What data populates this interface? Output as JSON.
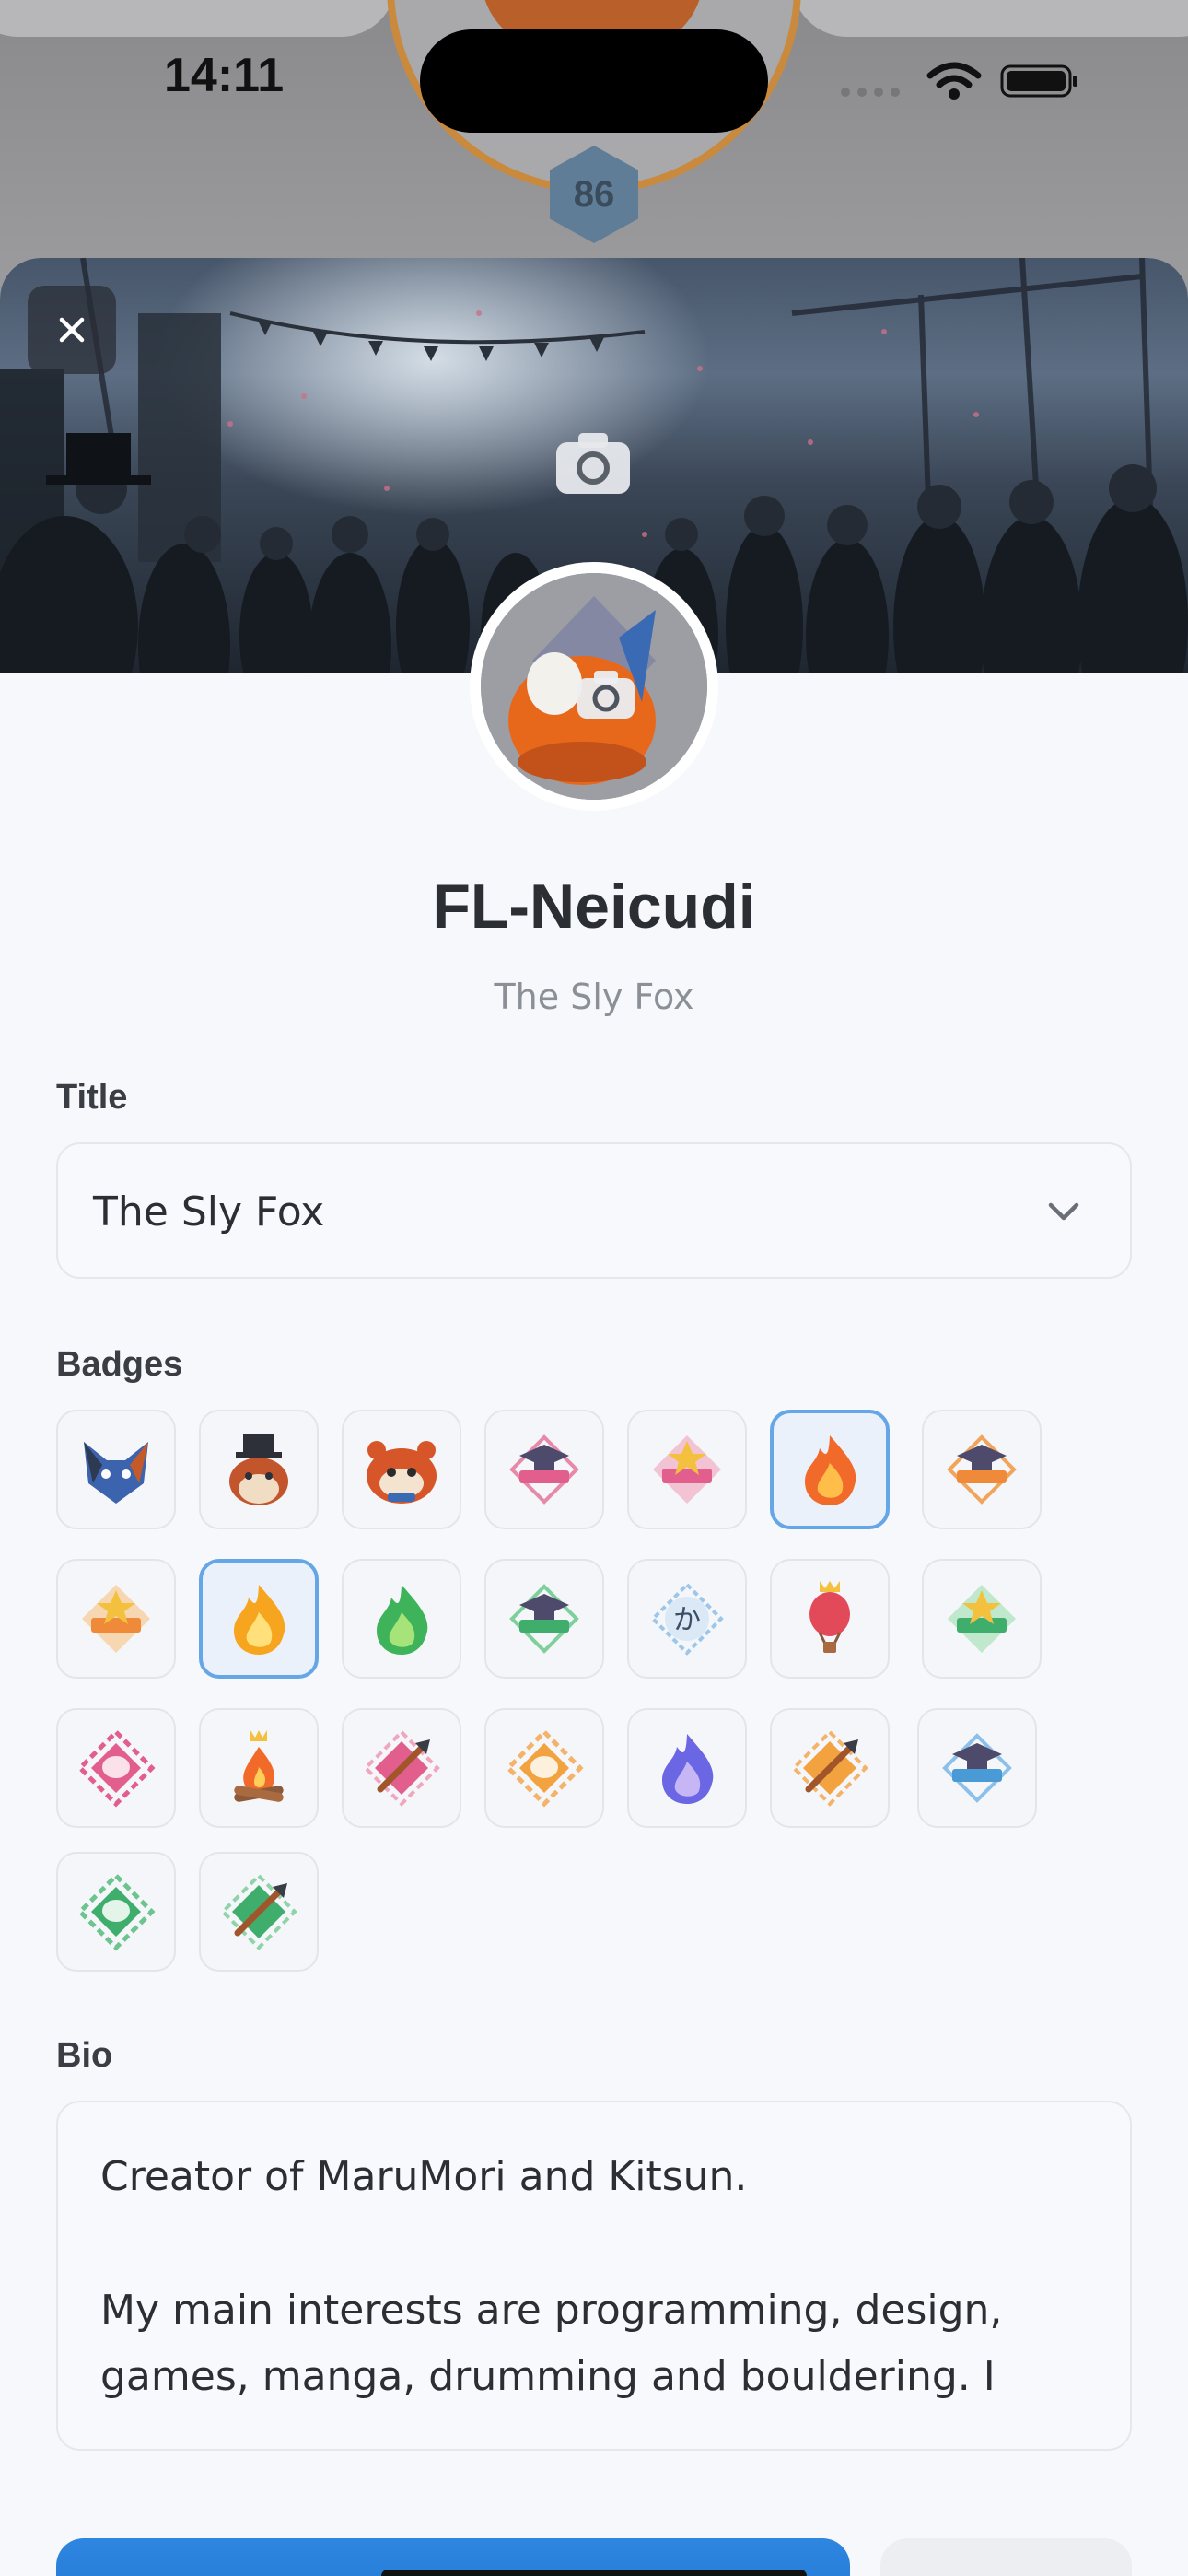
{
  "status_bar": {
    "time": "14:11"
  },
  "background": {
    "level_badge": "86"
  },
  "profile": {
    "username": "FL-Neicudi",
    "subtitle": "The Sly Fox"
  },
  "title_section": {
    "label": "Title",
    "selected_value": "The Sly Fox"
  },
  "badges_section": {
    "label": "Badges",
    "items": [
      {
        "icon": "blue-fox-mask-badge",
        "selected": false
      },
      {
        "icon": "red-panda-top-hat-badge",
        "selected": false
      },
      {
        "icon": "red-panda-badge",
        "selected": false
      },
      {
        "icon": "pink-graduation-cap-badge",
        "selected": false
      },
      {
        "icon": "pink-star-badge",
        "selected": false
      },
      {
        "icon": "orange-flame-badge",
        "selected": true
      },
      {
        "icon": "orange-graduation-cap-badge",
        "selected": false
      },
      {
        "icon": "orange-star-badge",
        "selected": false
      },
      {
        "icon": "yellow-flame-badge",
        "selected": true
      },
      {
        "icon": "green-flame-badge",
        "selected": false
      },
      {
        "icon": "green-graduation-cap-badge",
        "selected": false
      },
      {
        "icon": "blue-kana-badge",
        "selected": false
      },
      {
        "icon": "hot-air-balloon-badge",
        "selected": false
      },
      {
        "icon": "green-star-badge",
        "selected": false
      },
      {
        "icon": "pink-speech-bubble-badge",
        "selected": false
      },
      {
        "icon": "campfire-crown-badge",
        "selected": false
      },
      {
        "icon": "pink-brush-badge",
        "selected": false
      },
      {
        "icon": "orange-speech-bubble-badge",
        "selected": false
      },
      {
        "icon": "purple-flame-badge",
        "selected": false
      },
      {
        "icon": "orange-brush-badge",
        "selected": false
      },
      {
        "icon": "blue-graduation-cap-badge",
        "selected": false
      },
      {
        "icon": "green-speech-bubble-badge",
        "selected": false
      },
      {
        "icon": "green-brush-badge",
        "selected": false
      }
    ],
    "kana": "か"
  },
  "bio_section": {
    "label": "Bio",
    "lines": [
      "Creator of MaruMori and Kitsun.",
      "",
      "My main interests are programming, design,",
      "games, manga, drumming and bouldering. I"
    ]
  },
  "colors": {
    "primary_button": "#2a7fdb",
    "selected_badge_border": "#64a6e6",
    "sheet_background": "#f7f8fb"
  }
}
